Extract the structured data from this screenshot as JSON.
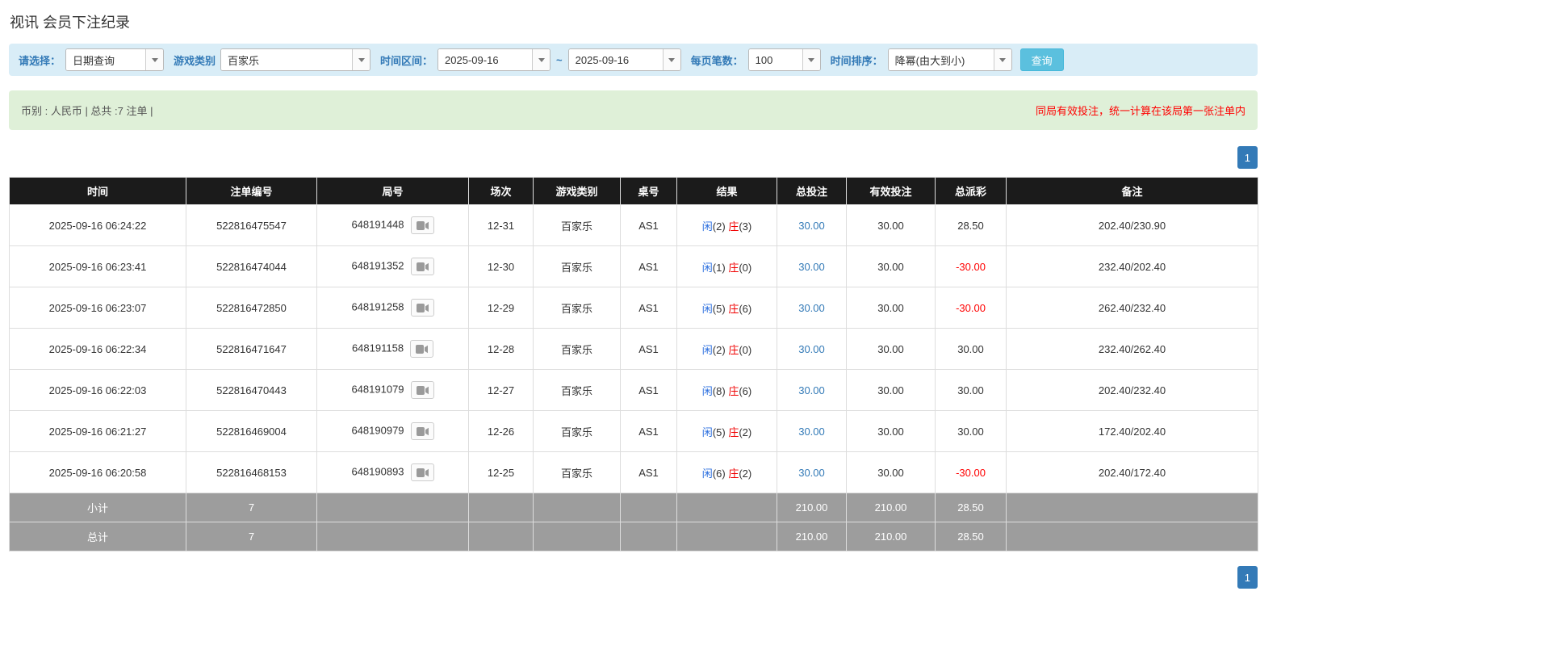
{
  "page": {
    "title": "视讯 会员下注纪录"
  },
  "filters": {
    "mode_label": "请选择：",
    "mode_value": "日期查询",
    "game_label": "游戏类别",
    "game_value": "百家乐",
    "range_label": "时间区间：",
    "date_from": "2025-09-16",
    "range_separator": "~",
    "date_to": "2025-09-16",
    "page_size_label": "每页笔数：",
    "page_size_value": "100",
    "sort_label": "时间排序：",
    "sort_value": "降幂(由大到小)",
    "query_button": "查询"
  },
  "summary_bar": {
    "left_text": "币别 : 人民币 | 总共 :7 注单 |",
    "right_notice": "同局有效投注，统一计算在该局第一张注单内"
  },
  "pagination": {
    "current_page": "1"
  },
  "table": {
    "headers": [
      "时间",
      "注单编号",
      "局号",
      "场次",
      "游戏类别",
      "桌号",
      "结果",
      "总投注",
      "有效投注",
      "总派彩",
      "备注"
    ],
    "rows": [
      {
        "time": "2025-09-16 06:24:22",
        "bet_id": "522816475547",
        "round_id": "648191448",
        "session": "12-31",
        "game_type": "百家乐",
        "table_no": "AS1",
        "xian": "闲(2)",
        "zhuang": "庄(3)",
        "total_bet": "30.00",
        "valid_bet": "30.00",
        "payout": "28.50",
        "note": "202.40/230.90"
      },
      {
        "time": "2025-09-16 06:23:41",
        "bet_id": "522816474044",
        "round_id": "648191352",
        "session": "12-30",
        "game_type": "百家乐",
        "table_no": "AS1",
        "xian": "闲(1)",
        "zhuang": "庄(0)",
        "total_bet": "30.00",
        "valid_bet": "30.00",
        "payout": "-30.00",
        "note": "232.40/202.40"
      },
      {
        "time": "2025-09-16 06:23:07",
        "bet_id": "522816472850",
        "round_id": "648191258",
        "session": "12-29",
        "game_type": "百家乐",
        "table_no": "AS1",
        "xian": "闲(5)",
        "zhuang": "庄(6)",
        "total_bet": "30.00",
        "valid_bet": "30.00",
        "payout": "-30.00",
        "note": "262.40/232.40"
      },
      {
        "time": "2025-09-16 06:22:34",
        "bet_id": "522816471647",
        "round_id": "648191158",
        "session": "12-28",
        "game_type": "百家乐",
        "table_no": "AS1",
        "xian": "闲(2)",
        "zhuang": "庄(0)",
        "total_bet": "30.00",
        "valid_bet": "30.00",
        "payout": "30.00",
        "note": "232.40/262.40"
      },
      {
        "time": "2025-09-16 06:22:03",
        "bet_id": "522816470443",
        "round_id": "648191079",
        "session": "12-27",
        "game_type": "百家乐",
        "table_no": "AS1",
        "xian": "闲(8)",
        "zhuang": "庄(6)",
        "total_bet": "30.00",
        "valid_bet": "30.00",
        "payout": "30.00",
        "note": "202.40/232.40"
      },
      {
        "time": "2025-09-16 06:21:27",
        "bet_id": "522816469004",
        "round_id": "648190979",
        "session": "12-26",
        "game_type": "百家乐",
        "table_no": "AS1",
        "xian": "闲(5)",
        "zhuang": "庄(2)",
        "total_bet": "30.00",
        "valid_bet": "30.00",
        "payout": "30.00",
        "note": "172.40/202.40"
      },
      {
        "time": "2025-09-16 06:20:58",
        "bet_id": "522816468153",
        "round_id": "648190893",
        "session": "12-25",
        "game_type": "百家乐",
        "table_no": "AS1",
        "xian": "闲(6)",
        "zhuang": "庄(2)",
        "total_bet": "30.00",
        "valid_bet": "30.00",
        "payout": "-30.00",
        "note": "202.40/172.40"
      }
    ],
    "subtotal": {
      "label": "小计",
      "count": "7",
      "total_bet": "210.00",
      "valid_bet": "210.00",
      "payout": "28.50"
    },
    "total": {
      "label": "总计",
      "count": "7",
      "total_bet": "210.00",
      "valid_bet": "210.00",
      "payout": "28.50"
    }
  },
  "colors": {
    "accent_blue": "#337ab7",
    "info_bg": "#d9edf7",
    "success_bg": "#dff0d8",
    "header_bg": "#1b1b1b",
    "summary_bg": "#9d9d9d",
    "negative_red": "#ff0000",
    "player_blue": "#2a6edf",
    "banker_red": "#f00000",
    "query_button_bg": "#5bc0de"
  }
}
